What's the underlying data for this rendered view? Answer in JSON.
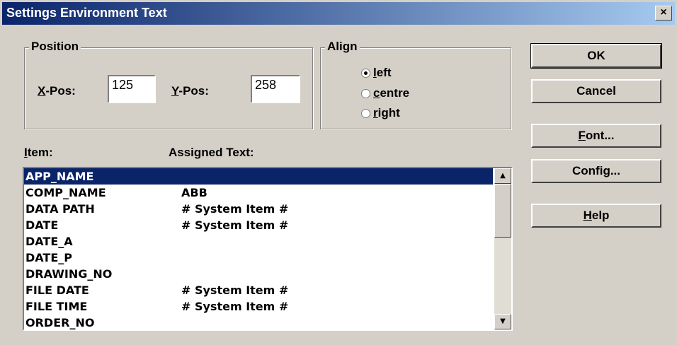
{
  "window": {
    "title": "Settings Environment Text",
    "close_glyph": "×"
  },
  "position": {
    "legend": "Position",
    "xpos_hot": "X",
    "xpos_rest": "-Pos:",
    "xpos_value": "125",
    "ypos_hot": "Y",
    "ypos_rest": "-Pos:",
    "ypos_value": "258"
  },
  "align": {
    "legend": "Align",
    "options": [
      {
        "hot": "l",
        "rest": "eft",
        "selected": true
      },
      {
        "hot": "c",
        "rest": "entre",
        "selected": false
      },
      {
        "hot": "r",
        "rest": "ight",
        "selected": false
      }
    ]
  },
  "list_headers": {
    "item_hot": "I",
    "item_rest": "tem:",
    "assigned": "Assigned Text:"
  },
  "items": [
    {
      "name": "APP_NAME",
      "text": "",
      "selected": true
    },
    {
      "name": "COMP_NAME",
      "text": "ABB"
    },
    {
      "name": "DATA PATH",
      "text": "# System Item #"
    },
    {
      "name": "DATE",
      "text": "# System Item #"
    },
    {
      "name": "DATE_A",
      "text": ""
    },
    {
      "name": "DATE_P",
      "text": ""
    },
    {
      "name": "DRAWING_NO",
      "text": ""
    },
    {
      "name": "FILE DATE",
      "text": "# System Item #"
    },
    {
      "name": "FILE TIME",
      "text": "# System Item #"
    },
    {
      "name": "ORDER_NO",
      "text": ""
    }
  ],
  "buttons": {
    "ok": "OK",
    "cancel": "Cancel",
    "font_hot": "F",
    "font_rest": "ont...",
    "config_pre": "Confi",
    "config_hot": "g",
    "config_rest": "...",
    "help_hot": "H",
    "help_rest": "elp"
  },
  "scrollbar": {
    "up_glyph": "▲",
    "down_glyph": "▼"
  }
}
